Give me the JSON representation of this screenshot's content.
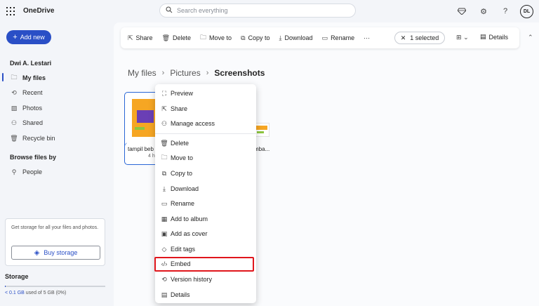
{
  "app": {
    "title": "OneDrive",
    "search_placeholder": "Search everything",
    "avatar_initials": "DL"
  },
  "add_new_label": "Add new",
  "sidebar": {
    "user": "Dwi A. Lestari",
    "items": [
      {
        "label": "My files",
        "icon": "folder-icon"
      },
      {
        "label": "Recent",
        "icon": "clock-icon"
      },
      {
        "label": "Photos",
        "icon": "photo-icon"
      },
      {
        "label": "Shared",
        "icon": "people-icon"
      },
      {
        "label": "Recycle bin",
        "icon": "trash-icon"
      }
    ],
    "browse_label": "Browse files by",
    "browse_items": [
      {
        "label": "People",
        "icon": "person-icon"
      }
    ],
    "storage_card": {
      "message": "Get storage for all your files and photos.",
      "button": "Buy storage"
    },
    "storage": {
      "title": "Storage",
      "used": "< 0.1 GB",
      "rest": "used of 5 GB (0%)",
      "fraction": 0.005
    }
  },
  "toolbar": {
    "share": "Share",
    "delete": "Delete",
    "move_to": "Move to",
    "copy_to": "Copy to",
    "download": "Download",
    "rename": "Rename",
    "more": "···",
    "selected": "1 selected",
    "details": "Details"
  },
  "breadcrumb": [
    "My files",
    "Pictures",
    "Screenshots"
  ],
  "files": [
    {
      "name": "tampil beb",
      "sub": "4 h"
    },
    {
      "name": "mba..."
    }
  ],
  "context_menu": [
    {
      "label": "Preview",
      "icon": "preview-icon"
    },
    {
      "label": "Share",
      "icon": "share-icon"
    },
    {
      "label": "Manage access",
      "icon": "manage-access-icon"
    },
    {
      "label": "Delete",
      "icon": "trash-icon"
    },
    {
      "label": "Move to",
      "icon": "move-icon"
    },
    {
      "label": "Copy to",
      "icon": "copy-icon"
    },
    {
      "label": "Download",
      "icon": "download-icon"
    },
    {
      "label": "Rename",
      "icon": "rename-icon"
    },
    {
      "label": "Add to album",
      "icon": "album-icon"
    },
    {
      "label": "Add as cover",
      "icon": "cover-icon"
    },
    {
      "label": "Edit tags",
      "icon": "tag-icon"
    },
    {
      "label": "Embed",
      "icon": "embed-icon"
    },
    {
      "label": "Version history",
      "icon": "history-icon"
    },
    {
      "label": "Details",
      "icon": "details-icon"
    }
  ],
  "colors": {
    "accent": "#2a4fc6",
    "highlight": "#e0161c",
    "selection_border": "#2a67d6"
  }
}
